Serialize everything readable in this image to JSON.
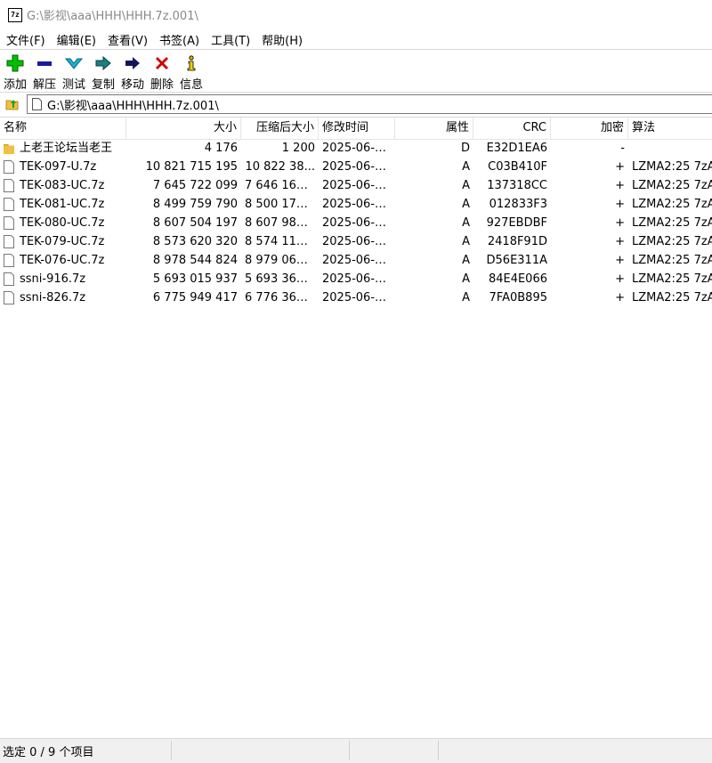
{
  "window": {
    "title": "G:\\影视\\aaa\\HHH\\HHH.7z.001\\",
    "app_icon_text": "7z"
  },
  "menu": [
    "文件(F)",
    "编辑(E)",
    "查看(V)",
    "书签(A)",
    "工具(T)",
    "帮助(H)"
  ],
  "toolbar": [
    {
      "label": "添加",
      "icon": "add-icon",
      "color": "#00c000"
    },
    {
      "label": "解压",
      "icon": "extract-icon",
      "color": "#1a1aa0"
    },
    {
      "label": "测试",
      "icon": "test-icon",
      "color": "#1aa0c0"
    },
    {
      "label": "复制",
      "icon": "copy-icon",
      "color": "#1a7a7a"
    },
    {
      "label": "移动",
      "icon": "move-icon",
      "color": "#14145a"
    },
    {
      "label": "删除",
      "icon": "delete-icon",
      "color": "#d00000"
    },
    {
      "label": "信息",
      "icon": "info-icon",
      "color": "#d0b000"
    }
  ],
  "address": {
    "path": "G:\\影视\\aaa\\HHH\\HHH.7z.001\\"
  },
  "columns": [
    "名称",
    "大小",
    "压缩后大小",
    "修改时间",
    "属性",
    "CRC",
    "加密",
    "算法"
  ],
  "rows": [
    {
      "type": "folder",
      "name": "上老王论坛当老王",
      "size": "4 176",
      "packed": "1 200",
      "modified": "2025-06-1...",
      "attr": "D",
      "crc": "E32D1EA6",
      "enc": "-",
      "method": ""
    },
    {
      "type": "file",
      "name": "TEK-097-U.7z",
      "size": "10 821 715 195",
      "packed": "10 822 38...",
      "modified": "2025-06-1...",
      "attr": "A",
      "crc": "C03B410F",
      "enc": "+",
      "method": "LZMA2:25 7zA"
    },
    {
      "type": "file",
      "name": "TEK-083-UC.7z",
      "size": "7 645 722 099",
      "packed": "7 646 161 ...",
      "modified": "2025-06-1...",
      "attr": "A",
      "crc": "137318CC",
      "enc": "+",
      "method": "LZMA2:25 7zA"
    },
    {
      "type": "file",
      "name": "TEK-081-UC.7z",
      "size": "8 499 759 790",
      "packed": "8 500 179 ...",
      "modified": "2025-06-1...",
      "attr": "A",
      "crc": "012833F3",
      "enc": "+",
      "method": "LZMA2:25 7zA"
    },
    {
      "type": "file",
      "name": "TEK-080-UC.7z",
      "size": "8 607 504 197",
      "packed": "8 607 988 ...",
      "modified": "2025-06-1...",
      "attr": "A",
      "crc": "927EBDBF",
      "enc": "+",
      "method": "LZMA2:25 7zA"
    },
    {
      "type": "file",
      "name": "TEK-079-UC.7z",
      "size": "8 573 620 320",
      "packed": "8 574 116 ...",
      "modified": "2025-06-1...",
      "attr": "A",
      "crc": "2418F91D",
      "enc": "+",
      "method": "LZMA2:25 7zA"
    },
    {
      "type": "file",
      "name": "TEK-076-UC.7z",
      "size": "8 978 544 824",
      "packed": "8 979 068 ...",
      "modified": "2025-06-1...",
      "attr": "A",
      "crc": "D56E311A",
      "enc": "+",
      "method": "LZMA2:25 7zA"
    },
    {
      "type": "file",
      "name": "ssni-916.7z",
      "size": "5 693 015 937",
      "packed": "5 693 367 ...",
      "modified": "2025-06-1...",
      "attr": "A",
      "crc": "84E4E066",
      "enc": "+",
      "method": "LZMA2:25 7zA"
    },
    {
      "type": "file",
      "name": "ssni-826.7z",
      "size": "6 775 949 417",
      "packed": "6 776 368 ...",
      "modified": "2025-06-1...",
      "attr": "A",
      "crc": "7FA0B895",
      "enc": "+",
      "method": "LZMA2:25 7zA"
    }
  ],
  "status": {
    "selection": "选定 0 / 9 个项目"
  }
}
